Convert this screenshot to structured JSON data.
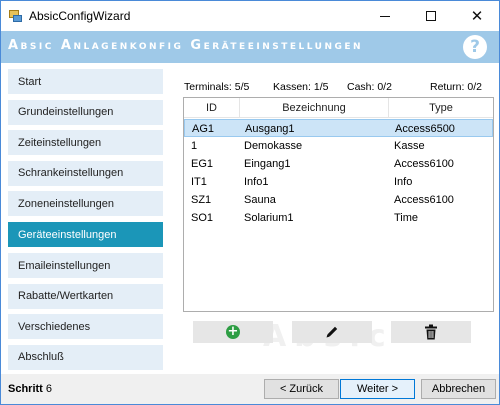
{
  "window": {
    "title": "AbsicConfigWizard"
  },
  "banner": {
    "title": "Absic Anlagenkonfig  Geräteeinstellungen",
    "help": "?"
  },
  "sidebar": {
    "items": [
      {
        "label": "Start"
      },
      {
        "label": "Grundeinstellungen"
      },
      {
        "label": "Zeiteinstellungen"
      },
      {
        "label": "Schrankeinstellungen"
      },
      {
        "label": "Zoneneinstellungen"
      },
      {
        "label": "Geräteeinstellungen"
      },
      {
        "label": "Emaileinstellungen"
      },
      {
        "label": "Rabatte/Wertkarten"
      },
      {
        "label": "Verschiedenes"
      },
      {
        "label": "Abschluß"
      }
    ],
    "active_index": 5
  },
  "stats": {
    "terminals": "Terminals: 5/5",
    "kassen": "Kassen: 1/5",
    "cash": "Cash: 0/2",
    "return": "Return: 0/2"
  },
  "table": {
    "columns": {
      "id": "ID",
      "bezeichnung": "Bezeichnung",
      "type": "Type"
    },
    "rows": [
      {
        "id": "AG1",
        "bezeichnung": "Ausgang1",
        "type": "Access6500"
      },
      {
        "id": "1",
        "bezeichnung": "Demokasse",
        "type": "Kasse"
      },
      {
        "id": "EG1",
        "bezeichnung": "Eingang1",
        "type": "Access6100"
      },
      {
        "id": "IT1",
        "bezeichnung": "Info1",
        "type": "Info"
      },
      {
        "id": "SZ1",
        "bezeichnung": "Sauna",
        "type": "Access6100"
      },
      {
        "id": "SO1",
        "bezeichnung": "Solarium1",
        "type": "Time"
      }
    ],
    "selected_index": 0
  },
  "watermark": "Absic",
  "icons": {
    "add": "plus-circle-icon",
    "edit": "pencil-icon",
    "delete": "trash-icon"
  },
  "footer": {
    "schritt_label": "Schritt",
    "schritt_value": "6",
    "back_label": "< Zurück",
    "next_label": "Weiter >",
    "cancel_label": "Abbrechen"
  },
  "colors": {
    "banner": "#9fc9e8",
    "active_nav": "#1b96b8",
    "nav_bg": "#e4eef7",
    "selected_row": "#cce4f7"
  }
}
